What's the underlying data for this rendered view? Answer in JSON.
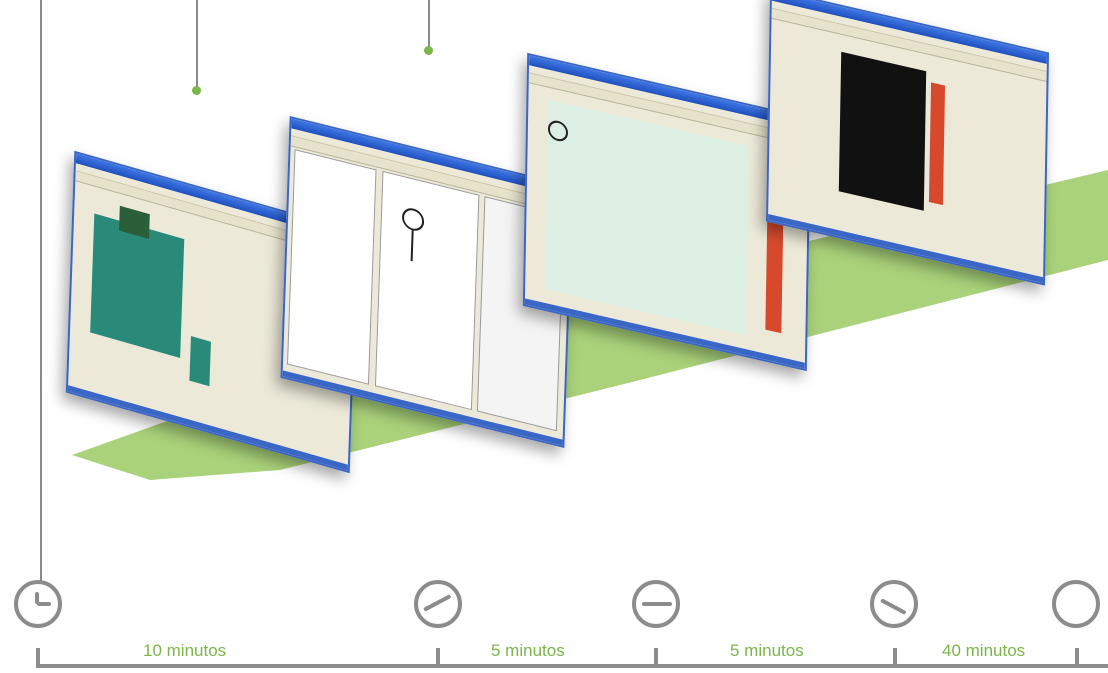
{
  "timeline": {
    "durations": [
      "10 minutos",
      "5 minutos",
      "5 minutos",
      "40 minutos"
    ]
  },
  "colors": {
    "accent_green": "#7ab648",
    "gray": "#8c8c8c",
    "window_blue": "#3a66c5"
  },
  "icons": [
    "clock-icon-1",
    "clock-icon-2",
    "clock-icon-3",
    "clock-icon-4",
    "clock-icon-5"
  ]
}
